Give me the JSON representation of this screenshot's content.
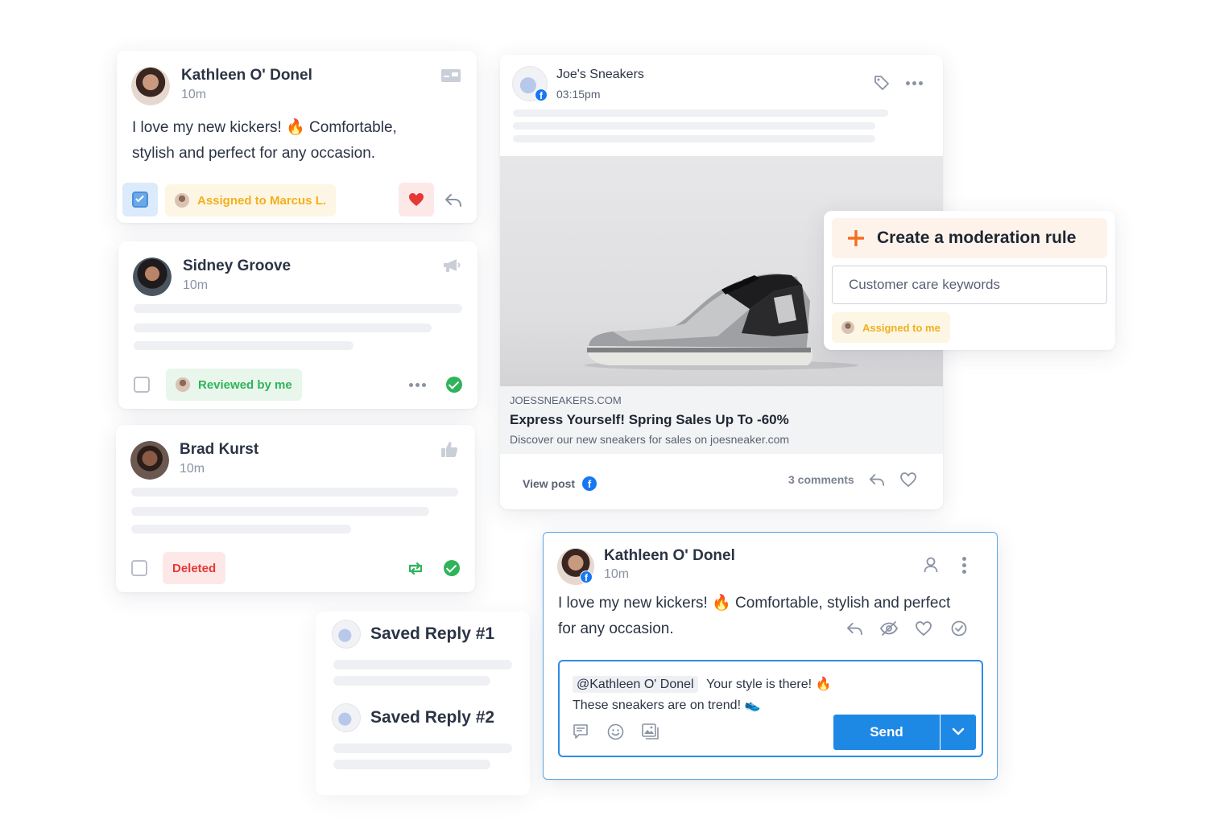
{
  "card1": {
    "name": "Kathleen O' Donel",
    "time": "10m",
    "message_line1": "I love my new kickers! 🔥 Comfortable,",
    "message_line2": "stylish and perfect for any occasion.",
    "assigned_label": "Assigned to Marcus L.",
    "icons": [
      "id-card-icon",
      "checkbox-checked-icon",
      "heart-icon",
      "reply-icon"
    ]
  },
  "card2": {
    "name": "Sidney Groove",
    "time": "10m",
    "reviewed_label": "Reviewed by me",
    "icons": [
      "megaphone-icon",
      "more-icon",
      "check-circle-icon"
    ]
  },
  "card3": {
    "name": "Brad Kurst",
    "time": "10m",
    "deleted_label": "Deleted",
    "icons": [
      "thumbs-up-icon",
      "retweet-icon",
      "check-circle-icon"
    ]
  },
  "post": {
    "page_name": "Joe's Sneakers",
    "time": "03:15pm",
    "link_domain": "JOESSNEAKERS.COM",
    "link_title": "Express Yourself! Spring Sales Up To -60%",
    "link_description": "Discover our new sneakers for sales on joesneaker.com",
    "view_post_label": "View post",
    "comments_label": "3 comments",
    "icons": [
      "tag-icon",
      "more-icon",
      "facebook-icon",
      "reply-icon",
      "heart-icon"
    ]
  },
  "moderation": {
    "title": "Create a moderation rule",
    "input_value": "Customer care keywords",
    "assigned_label": "Assigned to me"
  },
  "saved_replies": [
    {
      "label": "Saved Reply #1"
    },
    {
      "label": "Saved Reply #2"
    }
  ],
  "comment": {
    "name": "Kathleen O' Donel",
    "time": "10m",
    "message_line1": "I love my new kickers! 🔥 Comfortable, stylish and perfect",
    "message_line2": "for any occasion.",
    "reply_mention": "@Kathleen O' Donel",
    "reply_text_line1": "Your style is there! 🔥",
    "reply_text_line2": "These sneakers are on trend! 👟",
    "send_label": "Send",
    "icons": [
      "user-icon",
      "kebab-icon",
      "reply-icon",
      "hide-icon",
      "heart-icon",
      "check-circle-icon",
      "saved-replies-icon",
      "emoji-icon",
      "image-icon",
      "chevron-down-icon"
    ]
  },
  "colors": {
    "accent_blue": "#1e88e5",
    "assigned_yellow": "#f2b01e",
    "reviewed_green": "#2fb35b",
    "deleted_red": "#e53935",
    "moderation_orange": "#f36f21"
  }
}
